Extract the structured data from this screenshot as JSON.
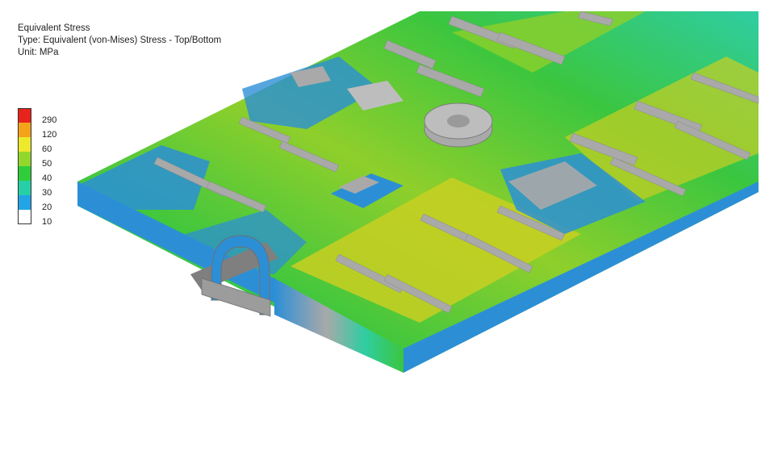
{
  "result": {
    "title": "Equivalent Stress",
    "type_line": "Type: Equivalent (von-Mises) Stress - Top/Bottom",
    "unit_line": "Unit: MPa"
  },
  "legend": {
    "levels": [
      {
        "label": "290",
        "color": "#e8231c"
      },
      {
        "label": "120",
        "color": "#f5a21b"
      },
      {
        "label": "60",
        "color": "#ecea2a"
      },
      {
        "label": "50",
        "color": "#93d62c"
      },
      {
        "label": "40",
        "color": "#2fcd3b"
      },
      {
        "label": "30",
        "color": "#26cfa6"
      },
      {
        "label": "20",
        "color": "#22a4e6"
      },
      {
        "label": "10",
        "color": "#ffffff"
      }
    ]
  },
  "model": {
    "description_icon": "fea-chassis-frame",
    "band_colors": {
      "unstressed": "#a9a9a9",
      "low": "#2c8fd6",
      "mid_low": "#2fcda2",
      "mid": "#3bc63f",
      "mid_high": "#8fcf2b",
      "high": "#c9cf22"
    }
  }
}
